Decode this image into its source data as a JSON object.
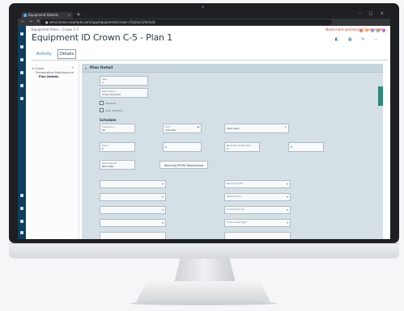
{
  "browser": {
    "tab_title": "Equipment Details",
    "tab_close": "×",
    "new_tab": "+",
    "window_controls": "– □ ×",
    "nav_buttons": "← → ↻ ⌂",
    "url": "● servicemax.example.com/app/equipment/crown-c5/plan/1/details"
  },
  "header": {
    "breadcrumb": "Equipment Plans  ›  Crown C-5",
    "user_link": "Need more assistance? Contact Help",
    "title": "Equipment ID Crown C-5 - Plan 1",
    "icons": "◧ ▦ ✎ ⋯"
  },
  "tabs": {
    "activity": "Activity",
    "details": "Details"
  },
  "tree": {
    "close": "×",
    "items": [
      {
        "label": "▾ Crown"
      },
      {
        "label": "Preventative Maintenance"
      },
      {
        "label": "Plan Details"
      }
    ]
  },
  "panel": {
    "caret": "▾",
    "title": "Plan Detail",
    "fields": {
      "plan": {
        "label": "Plan",
        "value": "1"
      },
      "description": {
        "label": "Description",
        "value": "Crown Pinnacle"
      }
    },
    "checks": [
      "Checked",
      "Auto Schedule"
    ],
    "section_title": "Schedule",
    "schedule": {
      "frequency": {
        "label": "Frequency",
        "value": "90"
      },
      "unit": {
        "label": "Unit",
        "value": "Calendar"
      },
      "start_date": {
        "label": "",
        "value": "Start Date"
      },
      "days": {
        "label": "Days",
        "value": "0"
      },
      "hours": {
        "label": "",
        "value": "0"
      },
      "next_due": {
        "label": "Next Due Date (Km)",
        "value": "0"
      },
      "next_value": {
        "label": "",
        "value": "0"
      },
      "template": {
        "label": "Template ID",
        "value": "BPF-2040"
      }
    },
    "recurring_button": "Recurring PM Per Maintenance",
    "dropdowns": [
      {
        "label": ""
      },
      {
        "label": "Recurring PM"
      },
      {
        "label": ""
      },
      {
        "label": "Task Priority"
      },
      {
        "label": ""
      },
      {
        "label": "Contract Code"
      },
      {
        "label": ""
      },
      {
        "label": "Trade Class Type"
      }
    ],
    "chevron": "▾"
  }
}
